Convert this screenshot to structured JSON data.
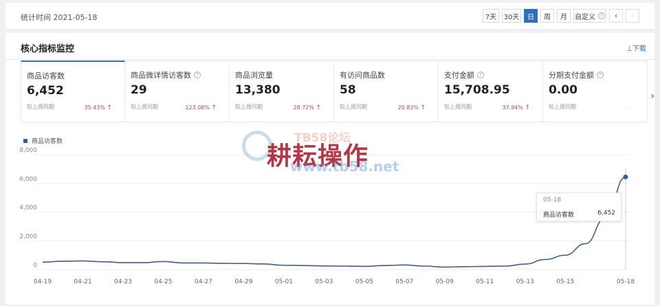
{
  "header": {
    "stat_date": "统计时间 2021-05-18",
    "ranges": [
      "7天",
      "30天",
      "日",
      "周",
      "月",
      "自定义"
    ],
    "active_range": "日",
    "prev": "‹",
    "next": "›"
  },
  "panel": {
    "title": "核心指标监控",
    "download": "⊥下载",
    "metrics": [
      {
        "label": "商品访客数",
        "value": "6,452",
        "compare": "较上周同期",
        "change": "35.43%",
        "arrow": "↑",
        "help": false
      },
      {
        "label": "商品微详情访客数",
        "value": "29",
        "compare": "较上周同期",
        "change": "123.08%",
        "arrow": "↑",
        "help": true
      },
      {
        "label": "商品浏览量",
        "value": "13,380",
        "compare": "较上周同期",
        "change": "28.72%",
        "arrow": "↑",
        "help": false
      },
      {
        "label": "有访问商品数",
        "value": "58",
        "compare": "较上周同期",
        "change": "20.83%",
        "arrow": "↑",
        "help": false
      },
      {
        "label": "支付金额",
        "value": "15,708.95",
        "compare": "较上周同期",
        "change": "37.94%",
        "arrow": "↑",
        "help": true
      },
      {
        "label": "分期支付金额",
        "value": "0.00",
        "compare": "较上周同期",
        "change": "-",
        "arrow": "",
        "help": true
      }
    ],
    "next_arrow": "›"
  },
  "watermark": {
    "text": "耕耘操作",
    "tb": "TB58论坛",
    "url": "www.tb58.net"
  },
  "tooltip": {
    "date": "05-18",
    "name": "商品访客数",
    "value": "6,452"
  },
  "chart_data": {
    "type": "line",
    "legend": "商品访客数",
    "ylim": [
      0,
      8000
    ],
    "yticks": [
      "0",
      "2,000",
      "4,000",
      "6,000",
      "8,000"
    ],
    "ytick_values": [
      0,
      2000,
      4000,
      6000,
      8000
    ],
    "xticks": [
      "04-19",
      "04-21",
      "04-23",
      "04-25",
      "04-27",
      "04-29",
      "05-01",
      "05-03",
      "05-05",
      "05-07",
      "05-09",
      "05-11",
      "05-13",
      "05-15",
      "05-18"
    ],
    "x": [
      "04-19",
      "04-20",
      "04-21",
      "04-22",
      "04-23",
      "04-24",
      "04-25",
      "04-26",
      "04-27",
      "04-28",
      "04-29",
      "04-30",
      "05-01",
      "05-02",
      "05-03",
      "05-04",
      "05-05",
      "05-06",
      "05-07",
      "05-08",
      "05-09",
      "05-10",
      "05-11",
      "05-12",
      "05-13",
      "05-14",
      "05-15",
      "05-16",
      "05-17",
      "05-18"
    ],
    "series": [
      {
        "name": "商品访客数",
        "color": "#3b5f8f",
        "values": [
          520,
          580,
          600,
          540,
          480,
          480,
          560,
          460,
          460,
          430,
          420,
          390,
          300,
          280,
          250,
          240,
          220,
          280,
          320,
          240,
          170,
          200,
          220,
          240,
          380,
          700,
          1000,
          1800,
          3600,
          6452
        ]
      }
    ]
  }
}
